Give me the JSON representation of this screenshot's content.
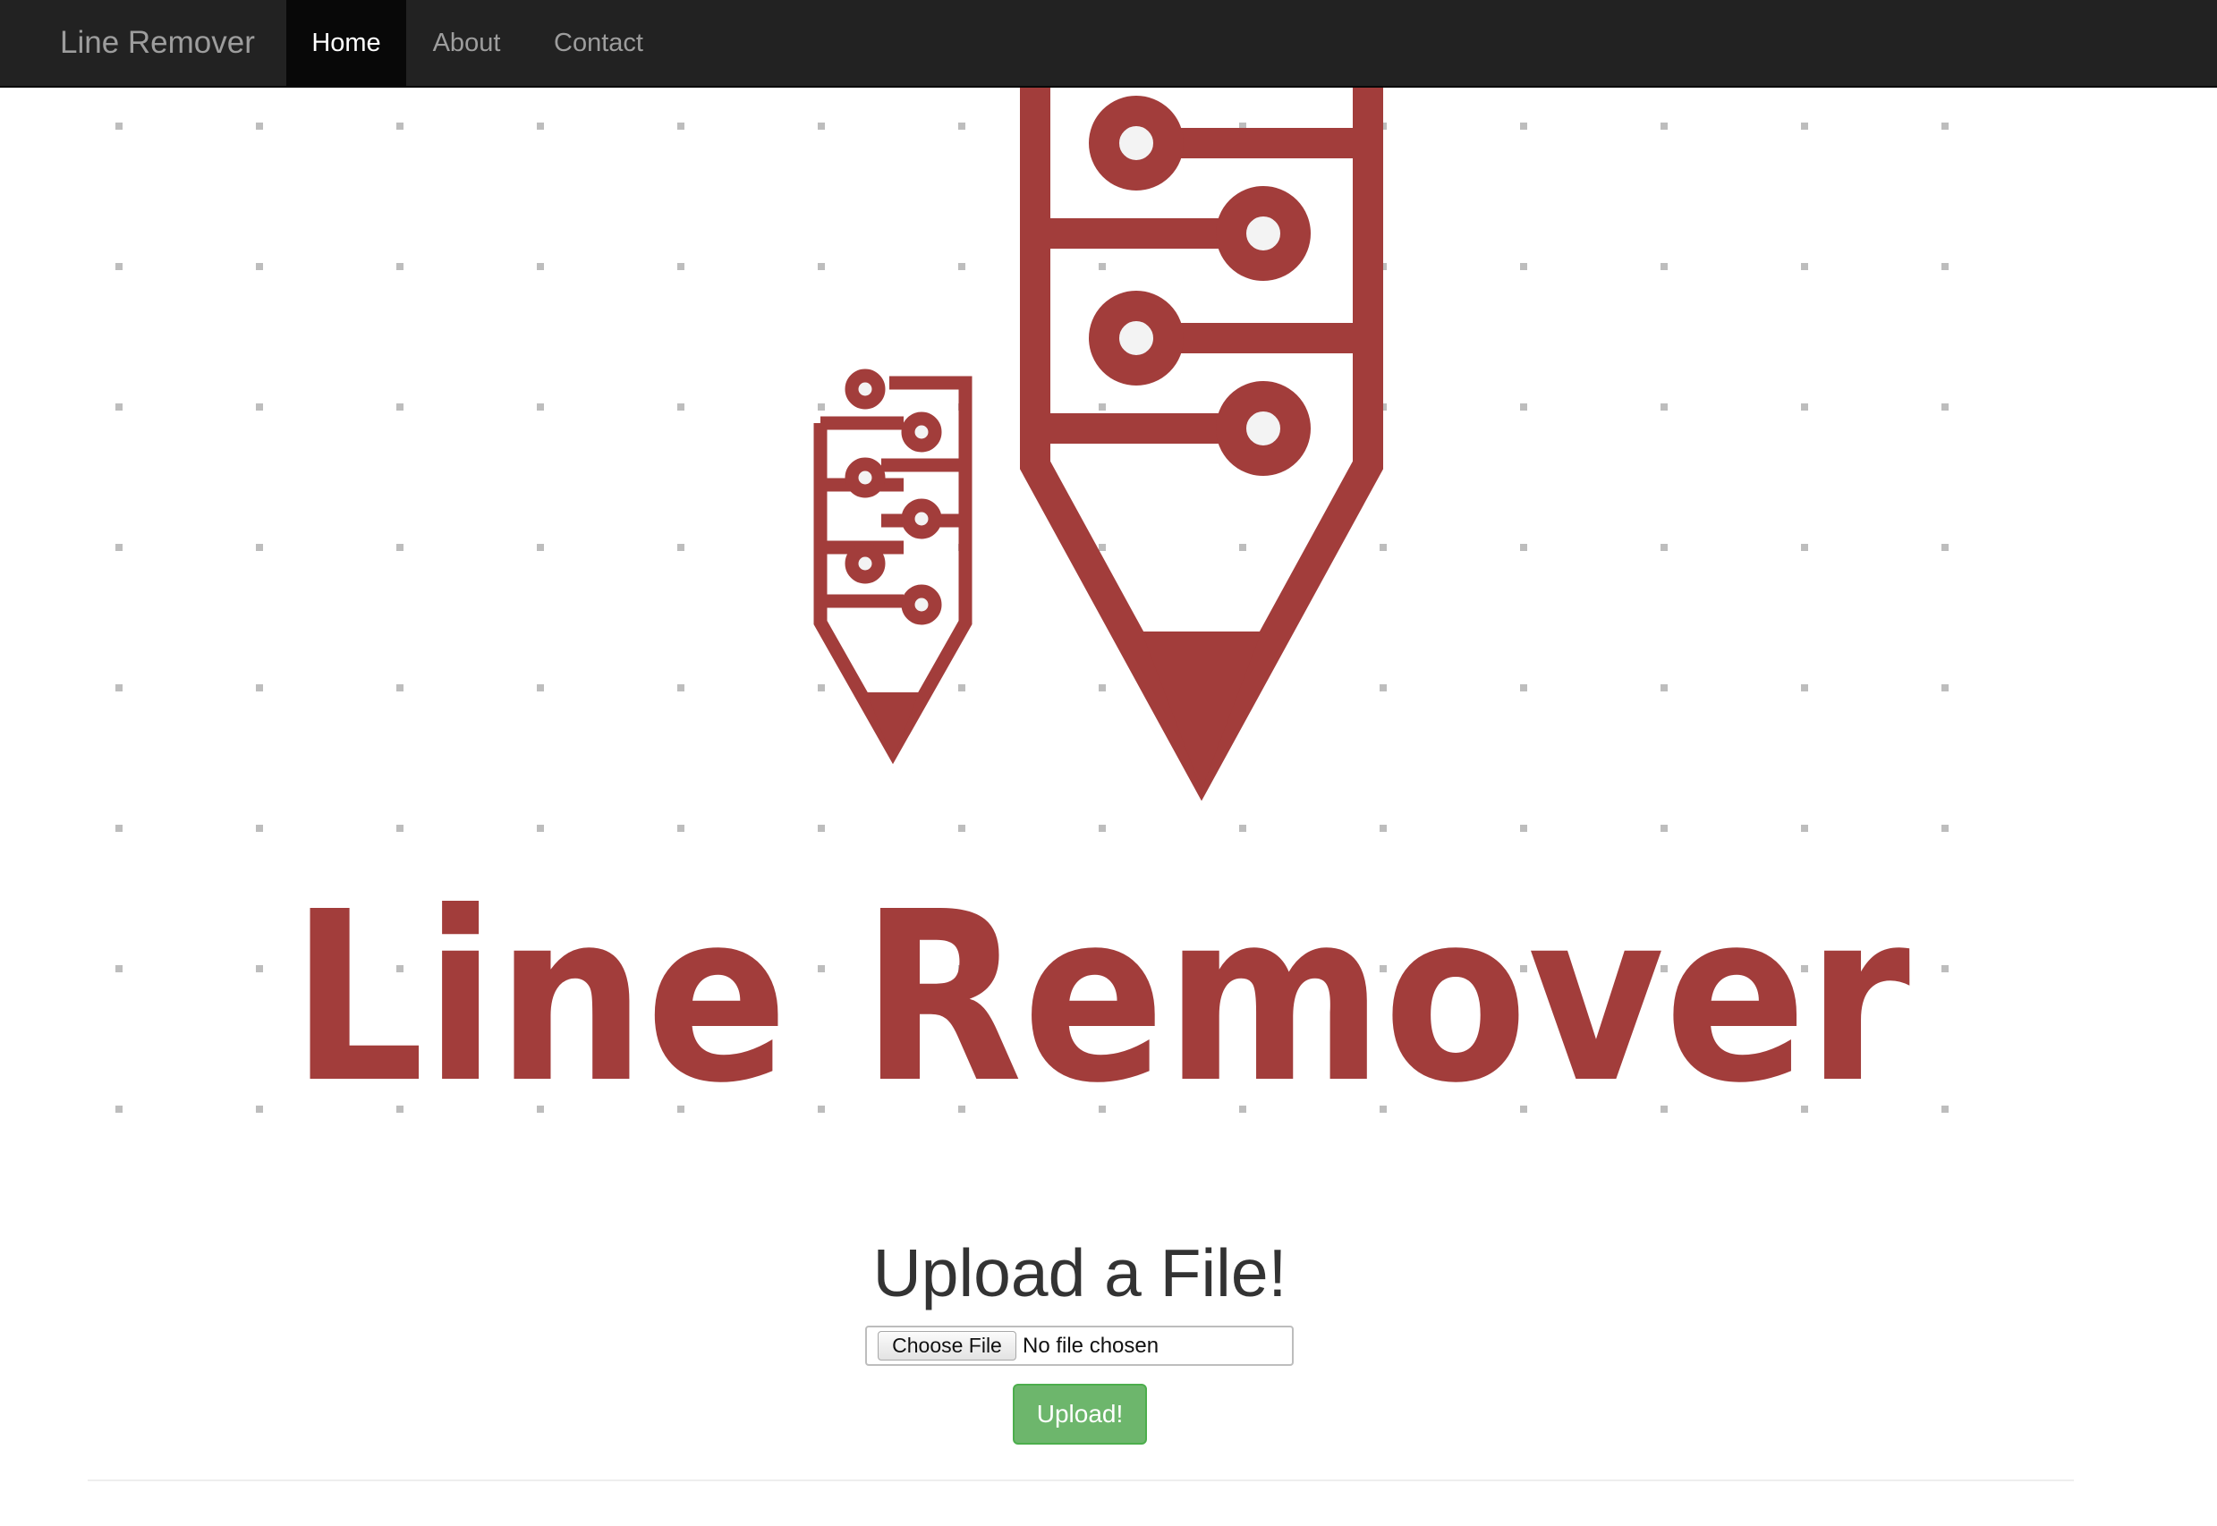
{
  "navbar": {
    "brand": "Line Remover",
    "items": [
      {
        "label": "Home",
        "active": true
      },
      {
        "label": "About",
        "active": false
      },
      {
        "label": "Contact",
        "active": false
      }
    ]
  },
  "logo": {
    "wordmark": "Line Remover",
    "color": "#a23d3b",
    "dot_color": "#bdbdbd",
    "icons": [
      "large-circuit-pencil-icon",
      "small-circuit-pencil-icon"
    ]
  },
  "upload": {
    "title": "Upload a File!",
    "choose_label": "Choose File",
    "file_status": "No file chosen",
    "submit_label": "Upload!",
    "submit_color": "#6db66c"
  },
  "colors": {
    "navbar_bg": "#222222",
    "nav_text": "#9d9d9d",
    "nav_active_bg": "#080808"
  }
}
